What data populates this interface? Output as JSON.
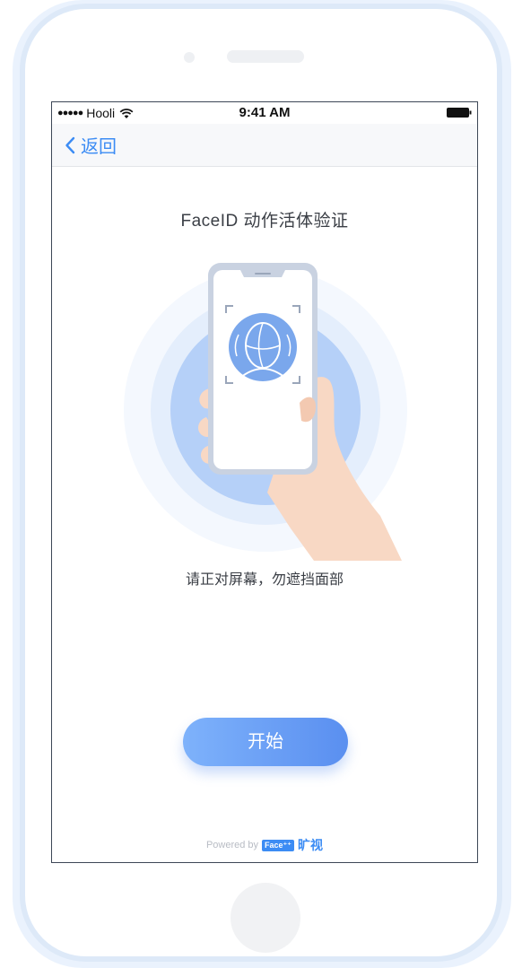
{
  "status_bar": {
    "signal": "●●●●●",
    "carrier": "Hooli",
    "time": "9:41 AM"
  },
  "nav": {
    "back_label": "返回"
  },
  "main": {
    "title": "FaceID 动作活体验证",
    "hint": "请正对屏幕，勿遮挡面部",
    "start_button": "开始"
  },
  "footer": {
    "powered_by": "Powered by",
    "logo_text": "Face⁺⁺",
    "brand": "旷视"
  },
  "colors": {
    "accent": "#3c8cf4",
    "button_start": "#7eb2fb",
    "button_end": "#5a8ff0",
    "text_primary": "#3b3f46",
    "frame_border": "#dde9f8"
  },
  "icons": [
    "wifi-icon",
    "battery-icon",
    "chevron-left-icon",
    "phone-face-scan-illustration"
  ]
}
